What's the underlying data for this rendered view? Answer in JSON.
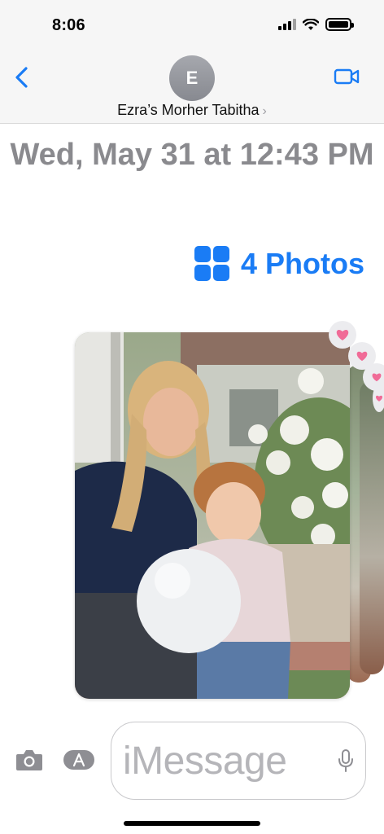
{
  "status_bar": {
    "time": "8:06"
  },
  "header": {
    "avatar_initial": "E",
    "contact_name": "Ezra’s Morher Tabitha",
    "chevron": "›",
    "icons": {
      "back": "chevron-left-icon",
      "video": "video-camera-icon"
    }
  },
  "conversation": {
    "timestamp": "Wed, May 31 at 12:43 PM",
    "photos_link": {
      "label": "4 Photos",
      "icon": "photo-grid-icon"
    },
    "photo_stack": {
      "count": 4,
      "tapback_reaction": "heart",
      "tapback_color": "#f06b97"
    }
  },
  "compose": {
    "placeholder": "iMessage",
    "icons": {
      "camera": "camera-icon",
      "apps": "app-store-icon",
      "mic": "microphone-icon"
    }
  },
  "colors": {
    "accent": "#1a7cf5",
    "timestamp_gray": "#8a8a8e"
  }
}
